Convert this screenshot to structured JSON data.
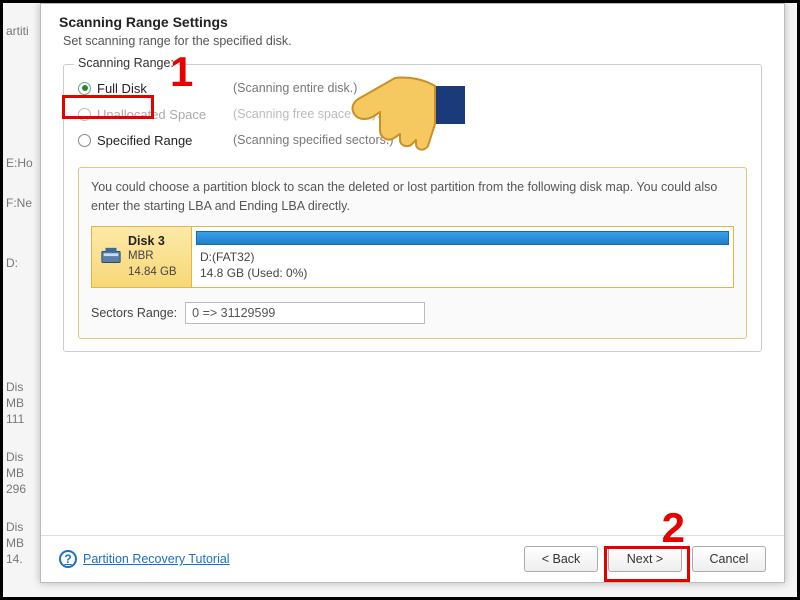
{
  "dialog": {
    "title": "Scanning Range Settings",
    "subtitle": "Set scanning range for the specified disk.",
    "range_legend": "Scanning Range:",
    "options": {
      "full": {
        "label": "Full Disk",
        "desc": "(Scanning entire disk.)"
      },
      "unalloc": {
        "label": "Unallocated Space",
        "desc": "(Scanning free space only.)"
      },
      "spec": {
        "label": "Specified Range",
        "desc": "(Scanning specified sectors.)"
      }
    },
    "disk_hint": "You could choose a partition block to scan the deleted or lost partition from the following disk map. You could also enter the starting LBA and Ending LBA directly.",
    "disk": {
      "name": "Disk 3",
      "scheme": "MBR",
      "size": "14.84 GB",
      "partition_name": "D:(FAT32)",
      "partition_detail": "14.8 GB (Used: 0%)"
    },
    "sectors_label": "Sectors Range:",
    "sectors_value": "0 => 31129599"
  },
  "footer": {
    "help_link": "Partition Recovery Tutorial",
    "back": "< Back",
    "next": "Next >",
    "cancel": "Cancel"
  },
  "callouts": {
    "one": "1",
    "two": "2"
  },
  "background": {
    "items": [
      "artiti",
      "E:Ho",
      "F:Ne",
      "D:",
      "Dis",
      "MB",
      "111",
      "Dis",
      "MB",
      "296",
      "Dis",
      "MB",
      "14."
    ]
  }
}
